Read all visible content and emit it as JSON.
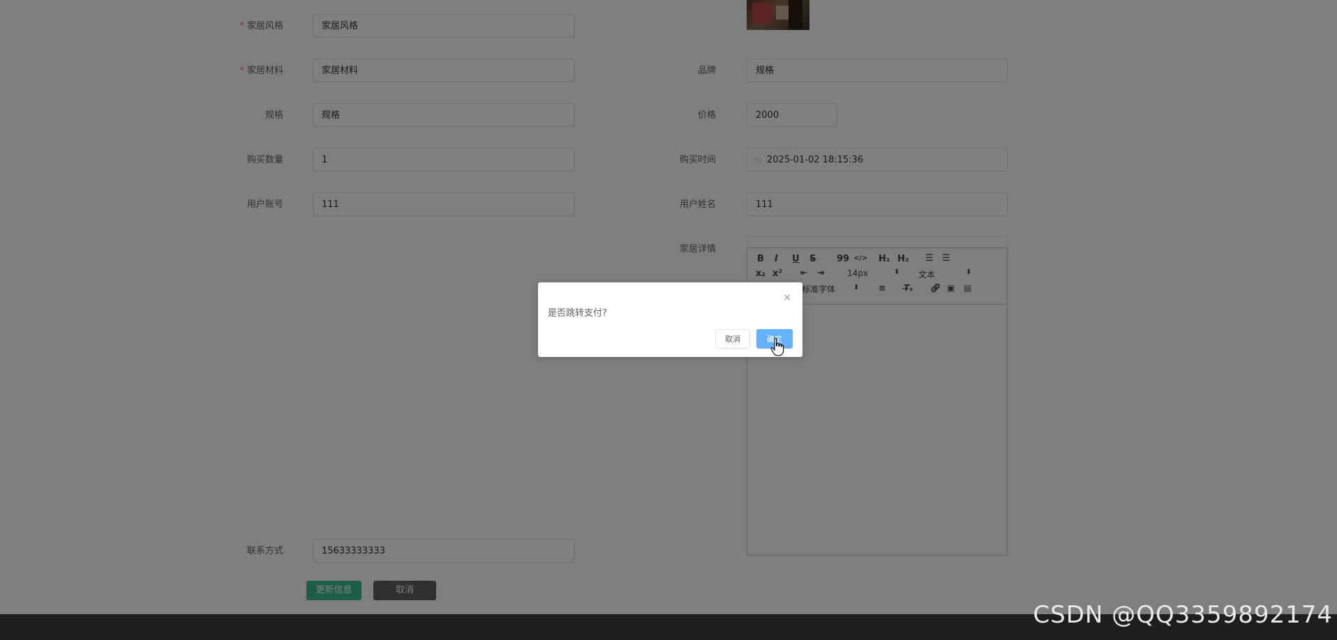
{
  "form": {
    "style_label": "家居风格",
    "style_value": "家居风格",
    "material_label": "家居材料",
    "material_value": "家居材料",
    "brand_label": "品牌",
    "brand_value": "规格",
    "spec_label": "规格",
    "spec_value": "规格",
    "price_label": "价格",
    "price_value": "2000",
    "qty_label": "购买数量",
    "qty_value": "1",
    "time_label": "购买时间",
    "time_value": "2025-01-02 18:15:36",
    "account_label": "用户账号",
    "account_value": "111",
    "username_label": "用户姓名",
    "username_value": "111",
    "detail_label": "家居详情",
    "contact_label": "联系方式",
    "contact_value": "15633333333",
    "required_mark": "*"
  },
  "editor": {
    "toolbar": {
      "bold": "B",
      "italic": "I",
      "underline": "U",
      "strike": "S",
      "quote": "99",
      "code": "</>",
      "h1": "H₁",
      "h2": "H₂",
      "ordered_list": "☰",
      "bullet_list": "☰",
      "sub": "x₂",
      "sup": "x²",
      "font_size": "14px",
      "text_type": "文本",
      "font_family": "标准字体"
    }
  },
  "actions": {
    "update_label": "更新信息",
    "cancel_label": "取消"
  },
  "dialog": {
    "close": "×",
    "message": "是否跳转支付?",
    "cancel_label": "取消",
    "ok_label": "确定"
  },
  "watermark": "CSDN @QQ3359892174"
}
